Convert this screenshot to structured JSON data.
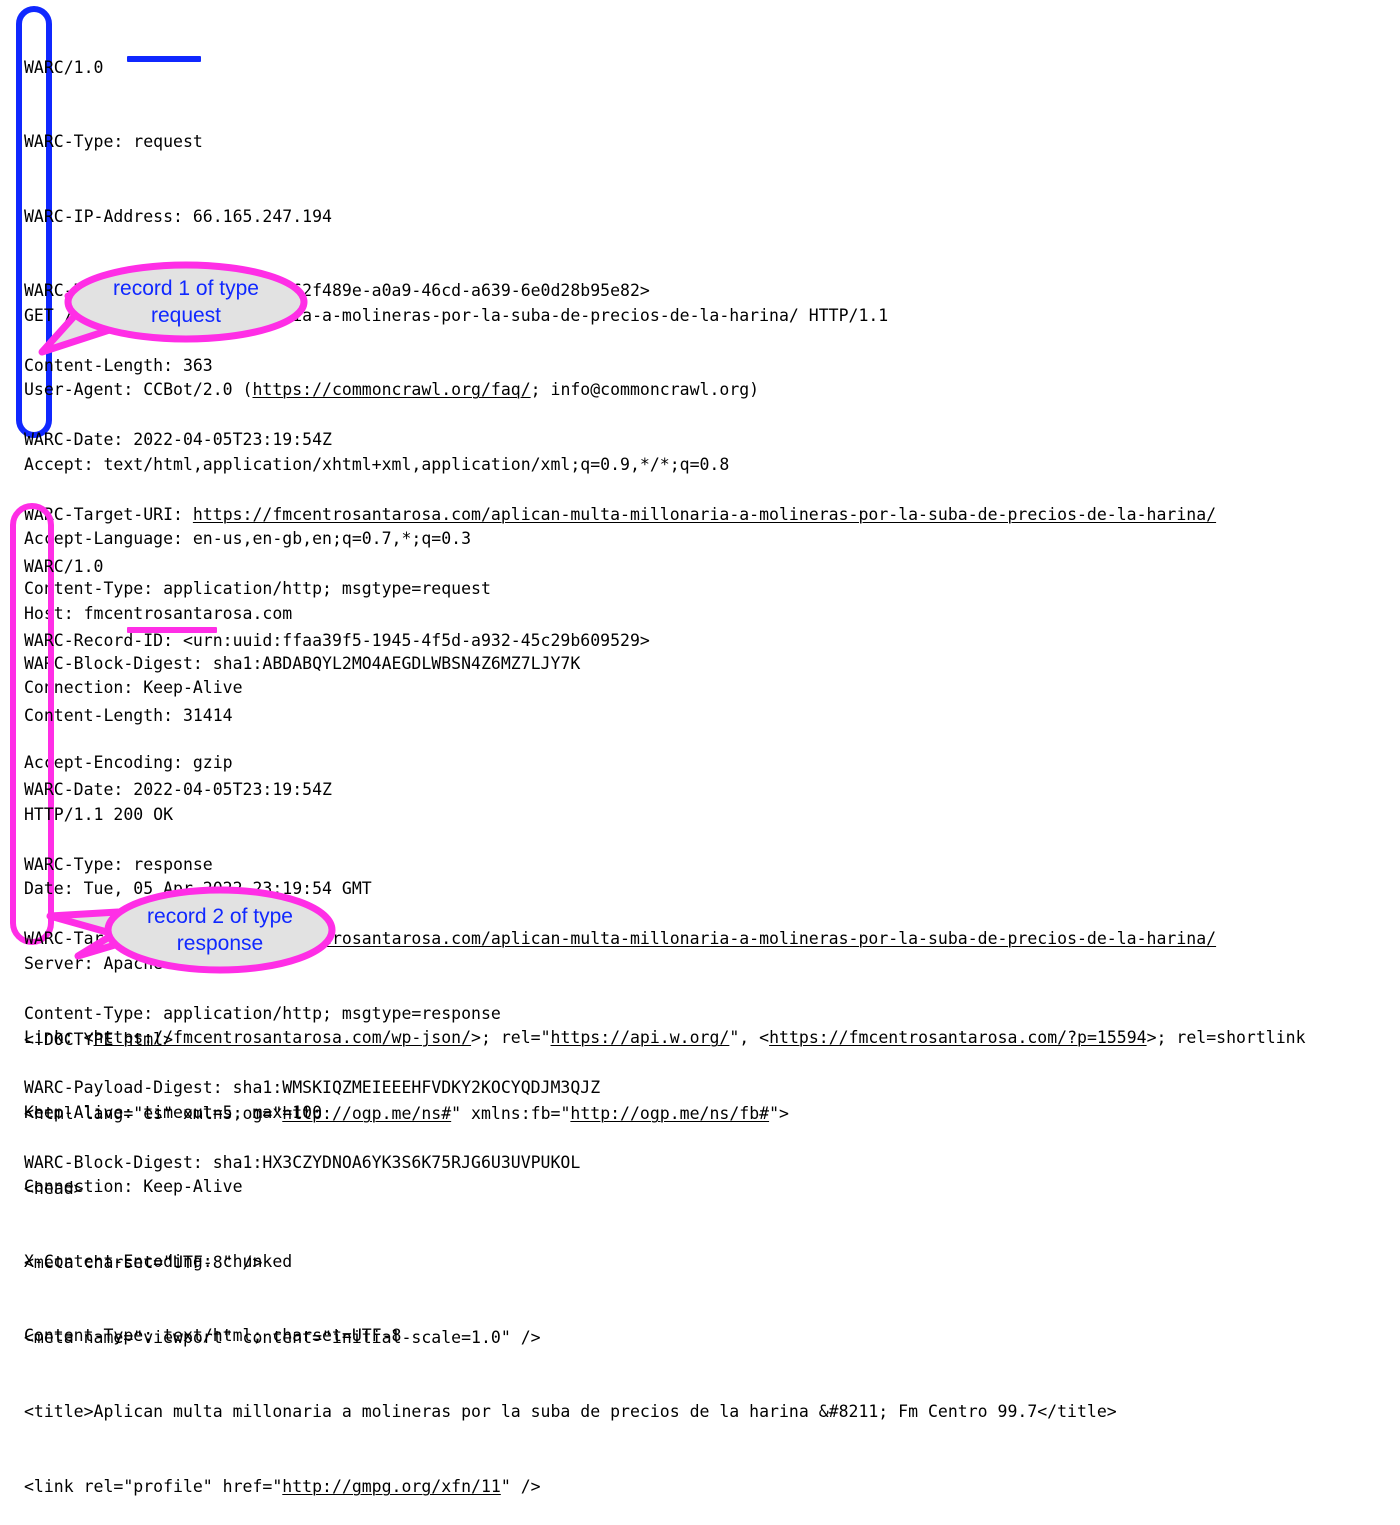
{
  "page": {
    "background_color": "#ffffff",
    "text_color": "#000000",
    "accent_blue": "#1028ff",
    "accent_magenta": "#ff2ee6",
    "bubble_fill": "#e2e2e2"
  },
  "record1": {
    "warc_headers": [
      "WARC/1.0",
      "WARC-Type: request",
      "WARC-IP-Address: 66.165.247.194",
      "WARC-Record-ID: <urn:uuid:962f489e-a0a9-46cd-a639-6e0d28b95e82>",
      "Content-Length: 363",
      "WARC-Date: 2022-04-05T23:19:54Z",
      "WARC-Target-URI: https://fmcentrosantarosa.com/aplican-multa-millonaria-a-molineras-por-la-suba-de-precios-de-la-harina/",
      "Content-Type: application/http; msgtype=request",
      "WARC-Block-Digest: sha1:ABDABQYL2MO4AEGDLWBSN4Z6MZ7LJY7K"
    ],
    "http_lines": [
      "GET /aplican-multa-millonaria-a-molineras-por-la-suba-de-precios-de-la-harina/ HTTP/1.1",
      "User-Agent: CCBot/2.0 (https://commoncrawl.org/faq/; info@commoncrawl.org)",
      "Accept: text/html,application/xhtml+xml,application/xml;q=0.9,*/*;q=0.8",
      "Accept-Language: en-us,en-gb,en;q=0.7,*;q=0.3",
      "Host: fmcentrosantarosa.com",
      "Connection: Keep-Alive",
      "Accept-Encoding: gzip"
    ],
    "type_value": "request",
    "target_uri": "https://fmcentrosantarosa.com/aplican-multa-millonaria-a-molineras-por-la-suba-de-precios-de-la-harina/",
    "callout_label": "record 1 of type\nrequest"
  },
  "record2": {
    "warc_headers": [
      "WARC/1.0",
      "WARC-Record-ID: <urn:uuid:ffaa39f5-1945-4f5d-a932-45c29b609529>",
      "Content-Length: 31414",
      "WARC-Date: 2022-04-05T23:19:54Z",
      "WARC-Type: response",
      "WARC-Target-URI: https://fmcentrosantarosa.com/aplican-multa-millonaria-a-molineras-por-la-suba-de-precios-de-la-harina/",
      "Content-Type: application/http; msgtype=response",
      "WARC-Payload-Digest: sha1:WMSKIQZMEIEEEHFVDKY2KOCYQDJM3QJZ",
      "WARC-Block-Digest: sha1:HX3CZYDNOA6YK3S6K75RJG6U3UVPUKOL"
    ],
    "http_lines": [
      "HTTP/1.1 200 OK",
      "Date: Tue, 05 Apr 2022 23:19:54 GMT",
      "Server: Apache",
      "Link: <https://fmcentrosantarosa.com/wp-json/>; rel=\"https://api.w.org/\", <https://fmcentrosantarosa.com/?p=15594>; rel=shortlink",
      "Keep-Alive: timeout=5, max=100",
      "Connection: Keep-Alive",
      "X-Content-Encoding: chunked",
      "Content-Type: text/html; charset=UTF-8"
    ],
    "type_value": "response",
    "target_uri": "https://fmcentrosantarosa.com/aplican-multa-millonaria-a-molineras-por-la-suba-de-precios-de-la-harina/",
    "callout_label": "record 2 of type\nresponse"
  },
  "payload": {
    "html_lines": [
      "<!DOCTYPE html>",
      "<html lang=\"es\" xmlns:og=\"http://ogp.me/ns#\" xmlns:fb=\"http://ogp.me/ns/fb#\">",
      "<head>",
      "<meta charset=\"UTF-8\" />",
      "<meta name=\"viewport\" content=\"initial-scale=1.0\" />",
      "<title>Aplican multa millonaria a molineras por la suba de precios de la harina &#8211; Fm Centro 99.7</title>",
      "<link rel=\"profile\" href=\"http://gmpg.org/xfn/11\" />"
    ]
  }
}
